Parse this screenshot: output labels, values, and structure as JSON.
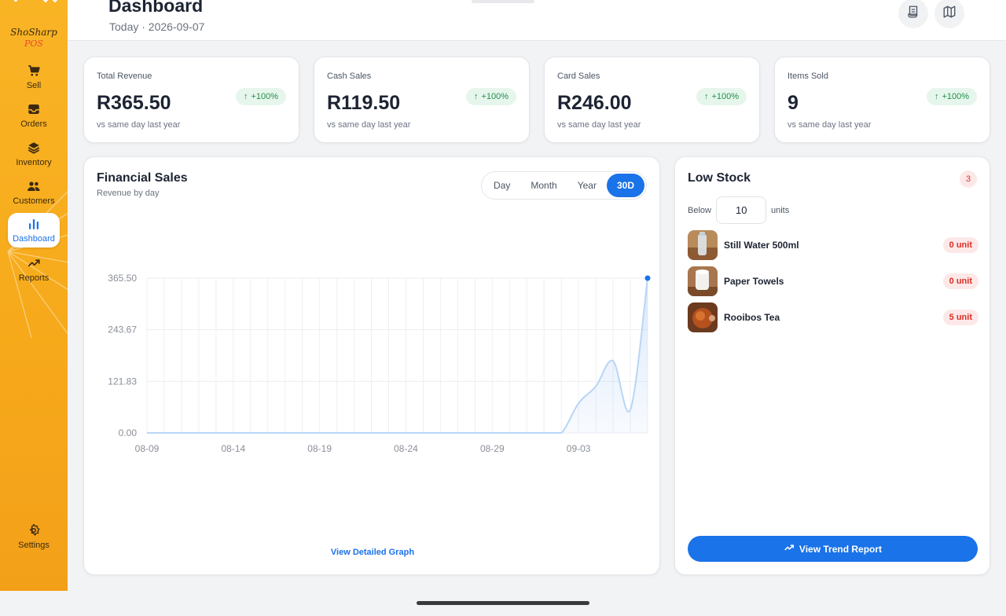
{
  "brand": {
    "name": "ShoSharp",
    "sub": "POS"
  },
  "sidebar": {
    "items": [
      {
        "label": "Sell",
        "icon": "cart-icon"
      },
      {
        "label": "Orders",
        "icon": "inbox-icon"
      },
      {
        "label": "Inventory",
        "icon": "layers-icon"
      },
      {
        "label": "Customers",
        "icon": "users-icon"
      },
      {
        "label": "Dashboard",
        "icon": "bar-chart-icon",
        "active": true
      },
      {
        "label": "Reports",
        "icon": "trend-icon"
      }
    ],
    "settings": {
      "label": "Settings",
      "icon": "gear-icon"
    }
  },
  "header": {
    "title": "Dashboard",
    "subtitle": "Today · 2026-09-07",
    "actions": [
      "receipt-icon",
      "map-icon"
    ]
  },
  "kpis": [
    {
      "label": "Total Revenue",
      "value": "R365.50",
      "badge": "+100%",
      "note": "vs same day last year"
    },
    {
      "label": "Cash Sales",
      "value": "R119.50",
      "badge": "+100%",
      "note": "vs same day last year"
    },
    {
      "label": "Card Sales",
      "value": "R246.00",
      "badge": "+100%",
      "note": "vs same day last year"
    },
    {
      "label": "Items Sold",
      "value": "9",
      "badge": "+100%",
      "note": "vs same day last year"
    }
  ],
  "financial": {
    "title": "Financial Sales",
    "subtitle": "Revenue by day",
    "ranges": [
      "Day",
      "Month",
      "Year",
      "30D"
    ],
    "active_range": "30D",
    "link": "View Detailed Graph"
  },
  "chart_data": {
    "type": "area",
    "title": "",
    "xlabel": "",
    "ylabel": "",
    "x": [
      "08-09",
      "08-10",
      "08-11",
      "08-12",
      "08-13",
      "08-14",
      "08-15",
      "08-16",
      "08-17",
      "08-18",
      "08-19",
      "08-20",
      "08-21",
      "08-22",
      "08-23",
      "08-24",
      "08-25",
      "08-26",
      "08-27",
      "08-28",
      "08-29",
      "08-30",
      "08-31",
      "09-01",
      "09-02",
      "09-03",
      "09-04",
      "09-05",
      "09-06",
      "09-07"
    ],
    "values": [
      0,
      0,
      0,
      0,
      0,
      0,
      0,
      0,
      0,
      0,
      0,
      0,
      0,
      0,
      0,
      0,
      0,
      0,
      0,
      0,
      0,
      0,
      0,
      0,
      0,
      70,
      110,
      170,
      55,
      365.5
    ],
    "x_tick_labels": [
      "08-09",
      "08-14",
      "08-19",
      "08-24",
      "08-29",
      "09-03"
    ],
    "y_tick_labels": [
      "0.00",
      "121.83",
      "243.67",
      "365.50"
    ],
    "ylim": [
      0,
      365.5
    ],
    "grid": true,
    "color": "#1a73e8"
  },
  "low_stock": {
    "title": "Low Stock",
    "count": "3",
    "below_label": "Below",
    "below_value": "10",
    "units_label": "units",
    "items": [
      {
        "name": "Still Water 500ml",
        "badge": "0 unit"
      },
      {
        "name": "Paper Towels",
        "badge": "0 unit"
      },
      {
        "name": "Rooibos Tea",
        "badge": "5 unit"
      }
    ],
    "button": "View Trend Report"
  }
}
